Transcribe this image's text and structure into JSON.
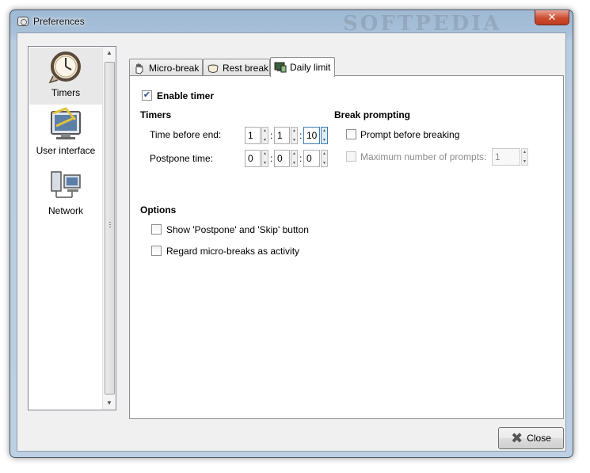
{
  "window": {
    "title": "Preferences",
    "watermark": "SOFTPEDIA",
    "close_glyph": "✕"
  },
  "sidebar": {
    "items": [
      {
        "label": "Timers",
        "icon": "clock-icon",
        "selected": true
      },
      {
        "label": "User interface",
        "icon": "user-interface-icon",
        "selected": false
      },
      {
        "label": "Network",
        "icon": "network-icon",
        "selected": false
      }
    ]
  },
  "tabs": [
    {
      "label": "Micro-break",
      "icon": "hand-icon",
      "active": false
    },
    {
      "label": "Rest break",
      "icon": "cup-icon",
      "active": false
    },
    {
      "label": "Daily limit",
      "icon": "monitor-icon",
      "active": true
    }
  ],
  "daily_limit": {
    "enable_timer": {
      "label": "Enable timer",
      "checked": true
    },
    "timers_heading": "Timers",
    "time_before_end": {
      "label": "Time before end:",
      "hours": "1",
      "minutes": "1",
      "seconds": "10"
    },
    "postpone_time": {
      "label": "Postpone time:",
      "hours": "0",
      "minutes": "0",
      "seconds": "0"
    },
    "colon": ":",
    "break_prompting_heading": "Break prompting",
    "prompt_before_breaking": {
      "label": "Prompt before breaking",
      "checked": false
    },
    "max_prompts": {
      "label": "Maximum number of prompts:",
      "value": "1",
      "enabled": false
    },
    "options_heading": "Options",
    "show_postpone_skip": {
      "label": "Show 'Postpone' and 'Skip' button",
      "checked": false
    },
    "regard_microbreaks": {
      "label": "Regard micro-breaks as activity",
      "checked": false
    }
  },
  "footer": {
    "close_label": "Close"
  },
  "colors": {
    "accent": "#2a4b8d",
    "titlebar": "#a8c0d8",
    "close_red": "#cc4b2f"
  }
}
